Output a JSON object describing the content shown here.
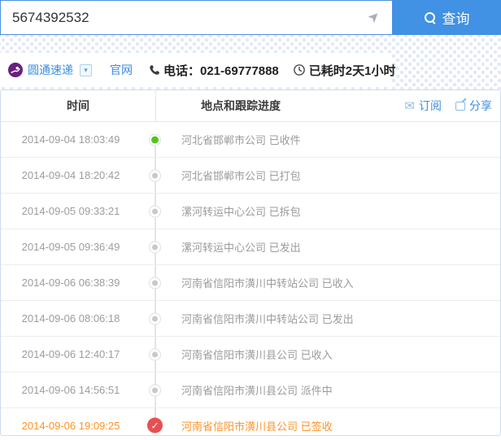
{
  "search": {
    "value": "5674392532",
    "button_label": "查询"
  },
  "courier": {
    "name": "圆通速递",
    "website_label": "官网",
    "phone_label": "电话：021-69777888",
    "elapsed_label": "已耗时2天1小时"
  },
  "table": {
    "col_time": "时间",
    "col_progress": "地点和跟踪进度",
    "subscribe_label": "订阅",
    "share_label": "分享",
    "rows": [
      {
        "time": "2014-09-04 18:03:49",
        "text": "河北省邯郸市公司 已收件",
        "dot": "green",
        "highlight": false
      },
      {
        "time": "2014-09-04 18:20:42",
        "text": "河北省邯郸市公司 已打包",
        "dot": "gray",
        "highlight": false
      },
      {
        "time": "2014-09-05 09:33:21",
        "text": "漯河转运中心公司 已拆包",
        "dot": "gray",
        "highlight": false
      },
      {
        "time": "2014-09-05 09:36:49",
        "text": "漯河转运中心公司 已发出",
        "dot": "gray",
        "highlight": false
      },
      {
        "time": "2014-09-06 06:38:39",
        "text": "河南省信阳市潢川中转站公司 已收入",
        "dot": "gray",
        "highlight": false
      },
      {
        "time": "2014-09-06 08:06:18",
        "text": "河南省信阳市潢川中转站公司 已发出",
        "dot": "gray",
        "highlight": false
      },
      {
        "time": "2014-09-06 12:40:17",
        "text": "河南省信阳市潢川县公司 已收入",
        "dot": "gray",
        "highlight": false
      },
      {
        "time": "2014-09-06 14:56:51",
        "text": "河南省信阳市潢川县公司 派件中",
        "dot": "gray",
        "highlight": false
      },
      {
        "time": "2014-09-06 19:09:25",
        "text": "河南省信阳市潢川县公司 已签收",
        "dot": "check",
        "highlight": true
      }
    ]
  },
  "icons": {
    "send": "➤",
    "caret": "▾",
    "envelope": "✉",
    "check": "✓"
  },
  "colors": {
    "accent_blue": "#4191e4",
    "link_blue": "#3a8ce0",
    "green_dot": "#4fc61d",
    "gray_dot": "#c9c9c9",
    "signed_orange": "#ff9326",
    "signed_red": "#e85050",
    "logo_purple": "#6a1f7e",
    "dot_pattern": "#e3e9f6",
    "table_border": "#ccdcee"
  }
}
